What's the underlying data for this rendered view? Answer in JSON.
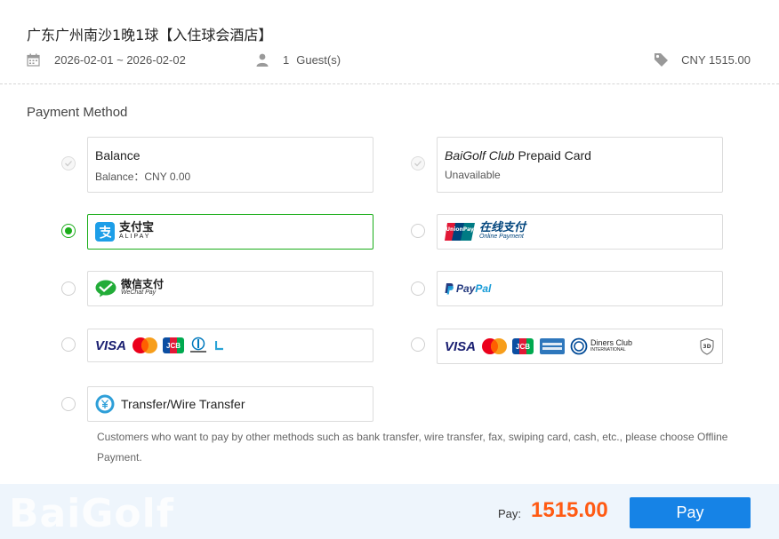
{
  "order": {
    "hotel_name": "广东广州南沙1晚1球【入住球会酒店】",
    "dates": "2026-02-01 ~ 2026-02-02",
    "guest_count": "1",
    "guest_label": "Guest(s)",
    "price": "CNY 1515.00"
  },
  "payment": {
    "section_title": "Payment Method",
    "balance": {
      "title": "Balance",
      "sub": "Balance：CNY 0.00"
    },
    "prepaid": {
      "title_italic": "BaiGolf Club",
      "title_rest": " Prepaid Card",
      "sub": "Unavailable"
    },
    "alipay": {
      "cn": "支付宝",
      "en": "ALIPAY"
    },
    "unionpay": {
      "badge": "UnionPay",
      "cn": "在线支付",
      "en": "Online Payment"
    },
    "wechat": {
      "cn": "微信支付",
      "en": "WeChat Pay"
    },
    "paypal": {
      "pay": "Pay",
      "pal": "Pal"
    },
    "cards_left": {
      "visa": "VISA",
      "jcb": "JCB"
    },
    "cards_right": {
      "visa": "VISA",
      "jcb": "JCB",
      "diners": "Diners Club",
      "diners_sub": "INTERNATIONAL",
      "secure": "3D"
    },
    "transfer": {
      "title": "Transfer/Wire Transfer"
    },
    "note": "Customers who want to pay by other methods such as bank transfer, wire transfer, fax, swiping card, cash, etc., please choose Offline Payment.",
    "selected": "alipay"
  },
  "footer": {
    "watermark": "BaiGolf",
    "pay_label": "Pay:",
    "amount": "1515.00",
    "pay_button": "Pay"
  },
  "colors": {
    "accent_green": "#1aad19",
    "pay_button": "#1683e6",
    "amount": "#ff5a13",
    "footer_bg": "#eef5fc"
  }
}
